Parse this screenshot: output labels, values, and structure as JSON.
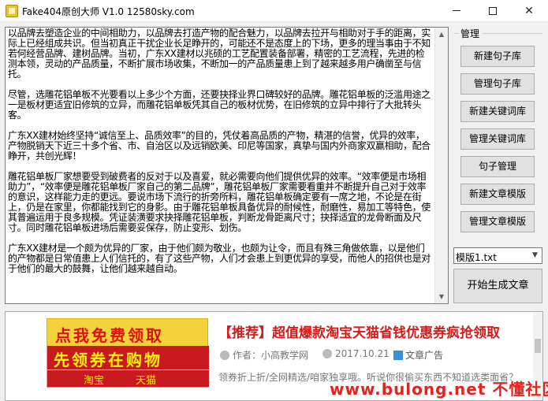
{
  "window": {
    "title": "Fake404原创大师 V1.0  12580sky.com",
    "minimize_icon": "minimize-icon",
    "maximize_icon": "maximize-icon",
    "close_icon": "close-icon"
  },
  "editor": {
    "content": "以品牌去塑造企业的中间相助力，以品牌去打造产物的配合魅力，以品牌去拉开与相助对于手的距离，实际上已经组成共识。但当初真正干扰企业长足睁开的，可能还不是态度上的下场，更多的理当事由于不知若何经营品牌、建树品牌。当初，广东XX建材以兆硕的工艺配置装备部署，精密的工艺流程，先进的检测本领，灵动的产品质量，不断扩展市场收集，不断加一的产品质量患上到了越来越多用户确凿至与信托。\n\n尽管，选雕花铝单板不光要看以上多少个方面，还要抉择业界口碑较好的品牌。雕花铝单板的泛滥用途之一是板材更适宜旧修筑的立异，而雕花铝单板凭其自己的板材优势，在旧修筑的立异中排行了大批转头客。\n\n广东XX建材始终坚持“诚信至上、品质效率”的目的，凭仗着高品质的产物，精湛的信誉，优异的效率，产物脱销天下近三十多个省、市、自治区以及远销欧美、印尼等国家，真挚与国内外商家双赢相助，配合睁开，共创光辉！\n\n雕花铝单板厂家想要受到破费者的反对于以及喜爱，就必需要向他们提供优异的效率。“效率便是市场相助力”，“效率便是雕花铝单板厂家自己的第二品牌”，雕花铝单板厂家需要看重并不断提升自己对于效率的意识，这样能力走的更远。要说市场下流行的折旁所料，雕花铝单板确定要有一席之地，不论是在街上，仍是在家里，你都能找到它的身影。由于雕花铝单板具备优异的耐候性，耐磨性，易加工等特色，使其普遍运用于良多规模。凭证装潢要求抉择雕花铝单板，判断龙骨距离尺寸；抉择适宜的龙骨断面及尺寸。同时雕花铝单板进场后需要妥保存，防止变形、划伤。\n\n广东XX建材是一个颇为优异的厂家，由于他们颇为敬业，也颇为让令，而且有殊三角做依靠，以是他们的产物都是日常值患上人们信托的，有了这些产物，人们才会患上到更优异的享受，而他人的招供也是对于他们的最大的鼓舞，让他们越来越自动。"
  },
  "sidebar": {
    "group_label": "管理",
    "buttons": [
      "新建句子库",
      "管理句子库",
      "新建关键词库",
      "管理关键词库",
      "句子管理",
      "新建文章模版",
      "管理文章模版"
    ],
    "template_select": "模版1.txt",
    "generate_button": "开始生成文章"
  },
  "web": {
    "banner_line1": "点我免费领取",
    "banner_line2": "先领券在购物",
    "banner_tag1": "淘宝",
    "banner_tag2": "天猫",
    "title": "【推荐】超值爆款淘宝天猫省钱优惠券疯抢领取",
    "author": "作者：小高教学网",
    "date": "2017.10.21",
    "category": "文章广告",
    "excerpt": "领券折上折/全网精选/咱家独享哦。听说你很偷买东西不知道选类面省？",
    "watermark": "www.bulong.net 不懂社区"
  }
}
